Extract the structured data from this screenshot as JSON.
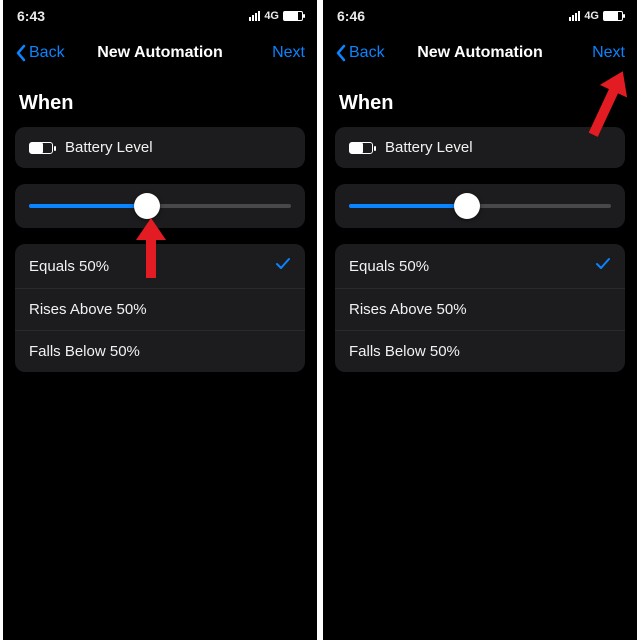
{
  "screens": [
    {
      "status": {
        "time": "6:43",
        "network": "4G"
      },
      "nav": {
        "back": "Back",
        "title": "New Automation",
        "next": "Next"
      },
      "section": "When",
      "trigger": {
        "label": "Battery Level"
      },
      "slider": {
        "percent": 45
      },
      "options": [
        {
          "label": "Equals 50%",
          "selected": true
        },
        {
          "label": "Rises Above 50%",
          "selected": false
        },
        {
          "label": "Falls Below 50%",
          "selected": false
        }
      ],
      "arrow_target": "slider"
    },
    {
      "status": {
        "time": "6:46",
        "network": "4G"
      },
      "nav": {
        "back": "Back",
        "title": "New Automation",
        "next": "Next"
      },
      "section": "When",
      "trigger": {
        "label": "Battery Level"
      },
      "slider": {
        "percent": 45
      },
      "options": [
        {
          "label": "Equals 50%",
          "selected": true
        },
        {
          "label": "Rises Above 50%",
          "selected": false
        },
        {
          "label": "Falls Below 50%",
          "selected": false
        }
      ],
      "arrow_target": "next"
    }
  ],
  "colors": {
    "accent": "#0a84ff",
    "arrow": "#e31b23"
  }
}
